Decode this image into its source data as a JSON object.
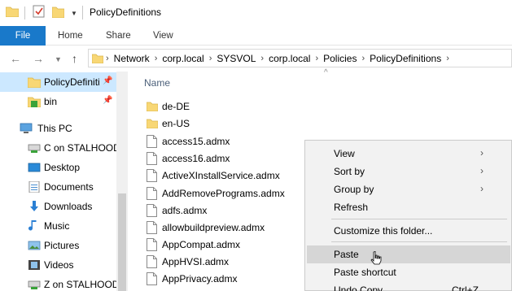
{
  "window": {
    "title": "PolicyDefinitions"
  },
  "ribbon": {
    "tabs": [
      "File",
      "Home",
      "Share",
      "View"
    ]
  },
  "address": {
    "crumbs": [
      "Network",
      "corp.local",
      "SYSVOL",
      "corp.local",
      "Policies",
      "PolicyDefinitions"
    ]
  },
  "nav": {
    "items": [
      {
        "label": "PolicyDefiniti",
        "icon": "folder-icon",
        "pinned": true,
        "selected": true
      },
      {
        "label": "bin",
        "icon": "folder-green-icon",
        "pinned": true
      },
      {
        "label": "This PC",
        "icon": "computer-icon"
      },
      {
        "label": "C on STALHOOD",
        "icon": "drive-icon"
      },
      {
        "label": "Desktop",
        "icon": "desktop-icon"
      },
      {
        "label": "Documents",
        "icon": "documents-icon"
      },
      {
        "label": "Downloads",
        "icon": "downloads-icon"
      },
      {
        "label": "Music",
        "icon": "music-icon"
      },
      {
        "label": "Pictures",
        "icon": "pictures-icon"
      },
      {
        "label": "Videos",
        "icon": "videos-icon"
      },
      {
        "label": "Z on STALHOOD",
        "icon": "drive-icon"
      }
    ]
  },
  "filelist": {
    "column": "Name",
    "items": [
      {
        "name": "de-DE",
        "type": "folder"
      },
      {
        "name": "en-US",
        "type": "folder"
      },
      {
        "name": "access15.admx",
        "type": "file"
      },
      {
        "name": "access16.admx",
        "type": "file"
      },
      {
        "name": "ActiveXInstallService.admx",
        "type": "file"
      },
      {
        "name": "AddRemovePrograms.admx",
        "type": "file"
      },
      {
        "name": "adfs.admx",
        "type": "file"
      },
      {
        "name": "allowbuildpreview.admx",
        "type": "file"
      },
      {
        "name": "AppCompat.admx",
        "type": "file"
      },
      {
        "name": "AppHVSI.admx",
        "type": "file"
      },
      {
        "name": "AppPrivacy.admx",
        "type": "file"
      }
    ]
  },
  "context_menu": {
    "items": [
      {
        "label": "View",
        "submenu": true
      },
      {
        "label": "Sort by",
        "submenu": true
      },
      {
        "label": "Group by",
        "submenu": true
      },
      {
        "label": "Refresh"
      },
      {
        "label": "Customize this folder..."
      },
      {
        "label": "Paste",
        "hover": true
      },
      {
        "label": "Paste shortcut"
      },
      {
        "label": "Undo Copy",
        "shortcut": "Ctrl+Z"
      }
    ]
  },
  "colors": {
    "accent": "#1979ca",
    "selection": "#cce8ff",
    "folder": "#f8d775"
  }
}
